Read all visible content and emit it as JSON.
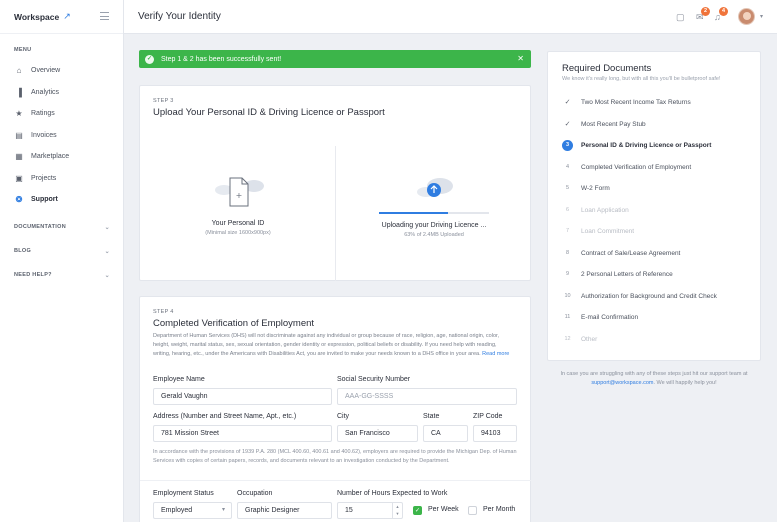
{
  "app": {
    "name": "Workspace",
    "page_title": "Verify Your Identity"
  },
  "sidebar": {
    "menu_title": "MENU",
    "items": [
      {
        "label": "Overview",
        "icon": "home-icon"
      },
      {
        "label": "Analytics",
        "icon": "bar-chart-icon"
      },
      {
        "label": "Ratings",
        "icon": "star-icon"
      },
      {
        "label": "Invoices",
        "icon": "invoice-icon"
      },
      {
        "label": "Marketplace",
        "icon": "store-icon"
      },
      {
        "label": "Projects",
        "icon": "folder-icon"
      },
      {
        "label": "Support",
        "icon": "lifebuoy-icon",
        "active": true
      }
    ],
    "sections": [
      "DOCUMENTATION",
      "BLOG",
      "NEED HELP?"
    ]
  },
  "header": {
    "notifications": {
      "inbox_count": "2",
      "alerts_count": "4"
    }
  },
  "alert": {
    "text": "Step 1 & 2 has been successfully sent!"
  },
  "step3": {
    "label": "STEP 3",
    "title": "Upload Your Personal ID & Driving Licence or Passport",
    "id_upload": {
      "title": "Your Personal ID",
      "sub": "(Minimal size 1600x900px)"
    },
    "license_upload": {
      "title": "Uploading your Driving Licence ...",
      "sub": "63% of 2.4MB Uploaded",
      "progress": 0.63
    }
  },
  "step4": {
    "label": "STEP 4",
    "title": "Completed Verification of Employment",
    "description": "Department of Human Services (DHS) will not discriminate against any individual or group because of race, religion, age, national origin, color, height, weight, marital status, sex, sexual orientation, gender identity or expression, political beliefs or disability. If you need help with reading, writing, hearing, etc., under the Americans with Disabilities Act, you are invited to make your needs known to a DHS office in your area.",
    "read_more": "Read more",
    "fields": {
      "employee_name": {
        "label": "Employee Name",
        "value": "Gerald Vaughn"
      },
      "ssn": {
        "label": "Social Security Number",
        "placeholder": "AAA-GG-SSSS"
      },
      "address": {
        "label": "Address (Number and Street Name, Apt., etc.)",
        "value": "781 Mission Street"
      },
      "city": {
        "label": "City",
        "value": "San Francisco"
      },
      "state": {
        "label": "State",
        "value": "CA"
      },
      "zip": {
        "label": "ZIP Code",
        "value": "94103"
      },
      "employment_status": {
        "label": "Employment Status",
        "value": "Employed"
      },
      "occupation": {
        "label": "Occupation",
        "value": "Graphic Designer"
      },
      "hours": {
        "label": "Number of Hours Expected to Work",
        "value": "15"
      }
    },
    "legal": "In accordance with the provisions of 1939 P.A. 280 (MCL 400.60, 400.61 and 400.62), employers are required to provide the Michigan Dep. of Human Services with copies of certain papers, records, and documents relevant to an investigation conducted by the Department.",
    "per_week": "Per Week",
    "per_month": "Per Month"
  },
  "required_docs": {
    "title": "Required Documents",
    "subtitle": "We know it's really long, but with all this you'll be bulletproof safe!",
    "items": [
      {
        "num": "✓",
        "label": "Two Most Recent Income Tax Returns",
        "state": "done"
      },
      {
        "num": "✓",
        "label": "Most Recent Pay Stub",
        "state": "done"
      },
      {
        "num": "3",
        "label": "Personal ID & Driving Licence or Passport",
        "state": "current"
      },
      {
        "num": "4",
        "label": "Completed Verification of Employment",
        "state": "todo"
      },
      {
        "num": "5",
        "label": "W-2 Form",
        "state": "todo"
      },
      {
        "num": "6",
        "label": "Loan Application",
        "state": "disabled"
      },
      {
        "num": "7",
        "label": "Loan Commitment",
        "state": "disabled"
      },
      {
        "num": "8",
        "label": "Contract of Sale/Lease Agreement",
        "state": "todo"
      },
      {
        "num": "9",
        "label": "2 Personal Letters of Reference",
        "state": "todo"
      },
      {
        "num": "10",
        "label": "Authorization for Background and Credit Check",
        "state": "todo"
      },
      {
        "num": "11",
        "label": "E-mail Confirmation",
        "state": "todo"
      },
      {
        "num": "12",
        "label": "Other",
        "state": "disabled"
      }
    ],
    "help_line1": "In case you are struggling with any of these steps just hit our support team at",
    "help_email": "support@workspace.com",
    "help_line2": ". We will happily help you!"
  },
  "colors": {
    "accent": "#2f7de1",
    "success": "#3cb54a",
    "badge": "#f0743b"
  }
}
